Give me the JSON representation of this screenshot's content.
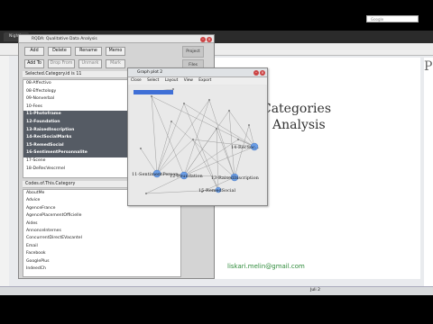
{
  "browser": {
    "tab_label": "Nightly",
    "search_placeholder": "Google",
    "slide_title_line1": "Categories",
    "slide_title_line2": "Analysis",
    "slide_email": "liskari.melin@gmail.com",
    "slide_right_char": "P"
  },
  "rqda": {
    "title": "RQDA: Qualitative Data Analysis",
    "buttons": {
      "add": "Add",
      "delete": "Delete",
      "rename": "Rename",
      "memo": "Memo",
      "add_to": "Add To",
      "drop_from": "Drop From",
      "unmark": "Unmark",
      "mark": "Mark"
    },
    "side_tabs": [
      "Project",
      "Files"
    ],
    "category_header": "Selected.Category.id is 11",
    "categories": [
      {
        "label": "08-Affectivo",
        "selected": false
      },
      {
        "label": "08-Effectology",
        "selected": false
      },
      {
        "label": "09-Nonverbal",
        "selected": false
      },
      {
        "label": "10-Fees",
        "selected": false
      },
      {
        "label": "11-Photoframe",
        "selected": true
      },
      {
        "label": "12-Foundation",
        "selected": true
      },
      {
        "label": "13-RaisedInscription",
        "selected": true
      },
      {
        "label": "14-ReclSocialMarks",
        "selected": true
      },
      {
        "label": "15-RemedSocial",
        "selected": true
      },
      {
        "label": "16-SentimentPersonnalite",
        "selected": true
      },
      {
        "label": "17-Scene",
        "selected": false
      },
      {
        "label": "18-DeRecVescrmel",
        "selected": false
      }
    ],
    "codes_header": "Codes.of.This.Category",
    "codes": [
      "AboutMe",
      "Advice",
      "AgenceFrance",
      "AgencePlacementOfficielle",
      "Aides",
      "AnnonceInternes",
      "ConcurrentDirectEVacantel",
      "Email",
      "Facebook",
      "GooglePlus",
      "IndeedCh"
    ]
  },
  "graph": {
    "title": "Graph plot 2",
    "menu": [
      "Close",
      "Select",
      "Layout",
      "View",
      "Export"
    ],
    "node_labels": [
      {
        "text": "14-RecSoc...",
        "id": "n14"
      },
      {
        "text": "13-RaisedInscription",
        "id": "n13"
      },
      {
        "text": "11-SentimentPerson...",
        "id": "n11"
      },
      {
        "text": "12-Foundation",
        "id": "n12"
      },
      {
        "text": "15-RemedSocial",
        "id": "n15"
      }
    ]
  },
  "taskbar": {
    "clock": "Juli 2"
  }
}
